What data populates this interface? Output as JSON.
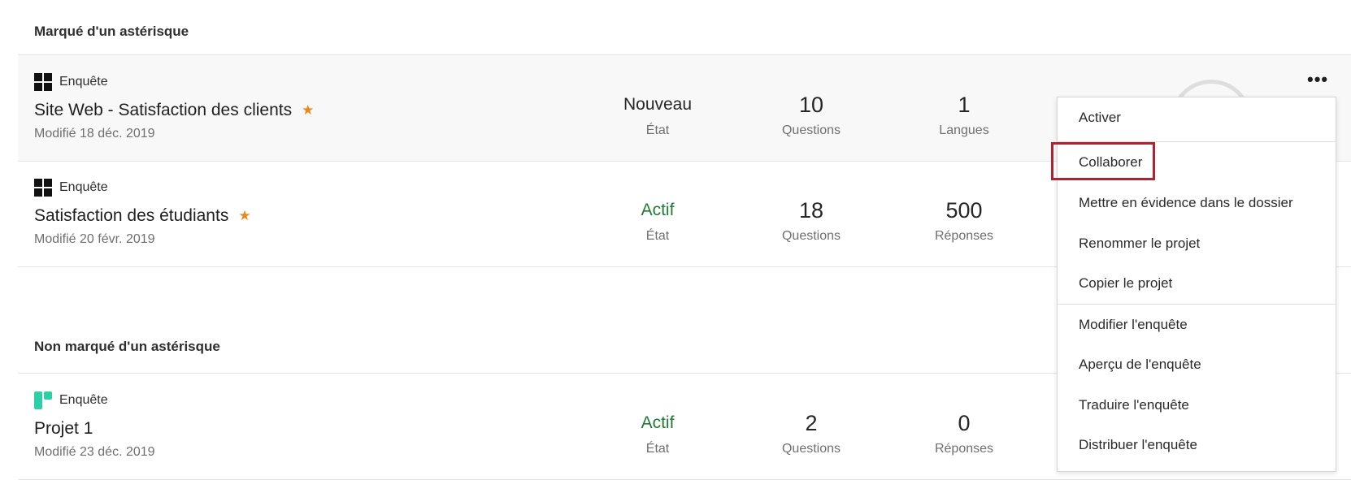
{
  "sections": {
    "starred_title": "Marqué d'un astérisque",
    "unstarred_title": "Non marqué d'un astérisque"
  },
  "projects": [
    {
      "type": "Enquête",
      "name": "Site Web - Satisfaction des clients",
      "modified": "Modifié 18 déc. 2019",
      "state": "Nouveau",
      "state_label": "État",
      "questions": "10",
      "questions_label": "Questions",
      "third_value": "1",
      "third_label": "Langues",
      "starred": true,
      "icon": "survey-black-icon"
    },
    {
      "type": "Enquête",
      "name": "Satisfaction des étudiants",
      "modified": "Modifié 20 févr. 2019",
      "state": "Actif",
      "state_label": "État",
      "questions": "18",
      "questions_label": "Questions",
      "third_value": "500",
      "third_label": "Réponses",
      "starred": true,
      "icon": "survey-black-icon"
    },
    {
      "type": "Enquête",
      "name": "Projet 1",
      "modified": "Modifié 23 déc. 2019",
      "state": "Actif",
      "state_label": "État",
      "questions": "2",
      "questions_label": "Questions",
      "third_value": "0",
      "third_label": "Réponses",
      "starred": false,
      "icon": "survey-teal-icon"
    }
  ],
  "star_glyph": "★",
  "menu": {
    "items": [
      "Activer",
      "Collaborer",
      "Mettre en évidence dans le dossier",
      "Renommer le projet",
      "Copier le projet",
      "Modifier l'enquête",
      "Aperçu de l'enquête",
      "Traduire l'enquête",
      "Distribuer l'enquête"
    ],
    "highlighted": "Collaborer"
  },
  "colors": {
    "accent_green": "#1f7a34",
    "star": "#e8891a",
    "highlight_red": "#b3202e",
    "teal_icon": "#2dcfa6"
  }
}
